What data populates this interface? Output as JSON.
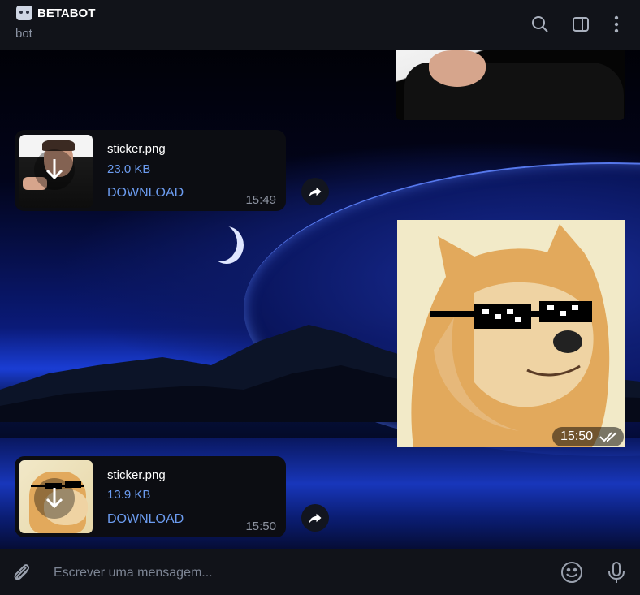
{
  "header": {
    "title": "BETABOT",
    "subtitle": "bot",
    "icons": [
      "search-icon",
      "sidebar-toggle-icon",
      "more-vertical-icon"
    ]
  },
  "messages": [
    {
      "type": "file",
      "name": "sticker.png",
      "size": "23.0 KB",
      "action": "DOWNLOAD",
      "time": "15:49"
    },
    {
      "type": "photo",
      "time": "15:50",
      "status": "read"
    },
    {
      "type": "file",
      "name": "sticker.png",
      "size": "13.9 KB",
      "action": "DOWNLOAD",
      "time": "15:50"
    }
  ],
  "composer": {
    "placeholder": "Escrever uma mensagem...",
    "icons": [
      "paperclip-icon",
      "emoji-icon",
      "microphone-icon"
    ]
  },
  "colors": {
    "accent": "#6c9cf0",
    "header_bg": "#111319",
    "bubble_bg": "#0c0d12"
  }
}
